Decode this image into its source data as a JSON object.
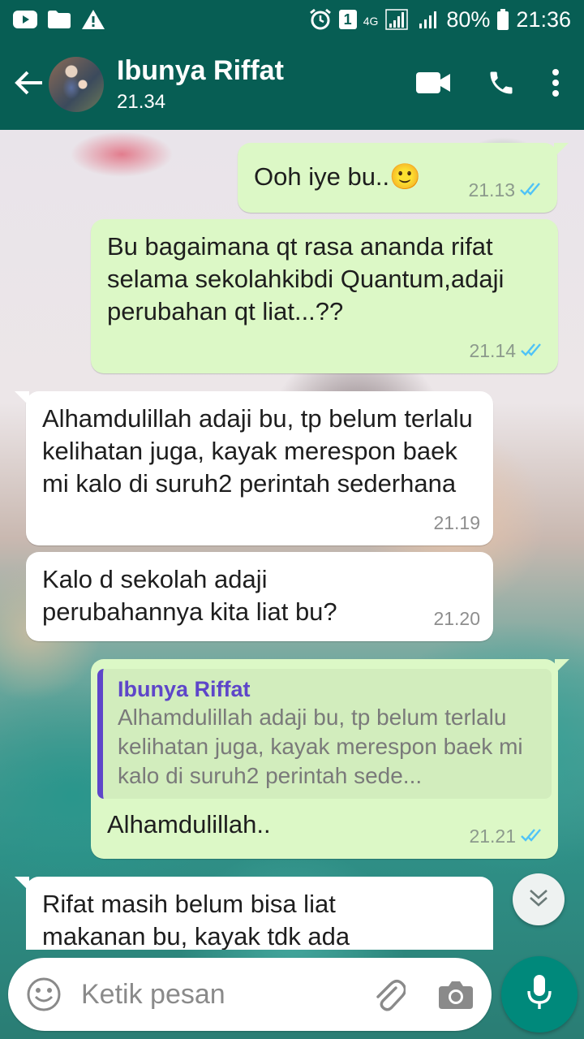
{
  "status_bar": {
    "sim": "1",
    "network": "4G",
    "battery": "80%",
    "time": "21:36"
  },
  "header": {
    "contact_name": "Ibunya Riffat",
    "last_seen": "21.34"
  },
  "messages": [
    {
      "direction": "out",
      "text": "Ooh iye bu..🙂",
      "time": "21.13",
      "status": "read"
    },
    {
      "direction": "out",
      "text": "Bu bagaimana qt rasa ananda rifat selama sekolahkibdi Quantum,adaji perubahan qt liat...??",
      "time": "21.14",
      "status": "read"
    },
    {
      "direction": "in",
      "text": "Alhamdulillah adaji bu, tp belum terlalu kelihatan juga, kayak merespon baek mi kalo di suruh2 perintah sederhana",
      "time": "21.19"
    },
    {
      "direction": "in",
      "text": "Kalo d sekolah adaji perubahannya kita liat bu?",
      "time": "21.20"
    },
    {
      "direction": "out",
      "quote_name": "Ibunya Riffat",
      "quote_text": "Alhamdulillah adaji bu, tp belum terlalu kelihatan juga, kayak merespon baek mi kalo di suruh2 perintah sede...",
      "text": "Alhamdulillah..",
      "time": "21.21",
      "status": "read"
    },
    {
      "direction": "in",
      "text": "Rifat masih belum bisa liat makanan bu, kayak tdk ada"
    }
  ],
  "composer": {
    "placeholder": "Ketik pesan"
  },
  "colors": {
    "header": "#075e54",
    "outgoing_bubble": "#dcf8c6",
    "incoming_bubble": "#ffffff",
    "read_ticks": "#4fc3f7",
    "quote_accent": "#5e46c9",
    "mic_button": "#00897b"
  },
  "icons": {
    "back": "arrow-left-icon",
    "video_call": "video-camera-icon",
    "voice_call": "phone-icon",
    "menu": "more-vertical-icon",
    "scroll_down": "double-chevron-down-icon",
    "emoji": "emoji-icon",
    "attach": "paperclip-icon",
    "camera": "camera-icon",
    "mic": "microphone-icon"
  }
}
